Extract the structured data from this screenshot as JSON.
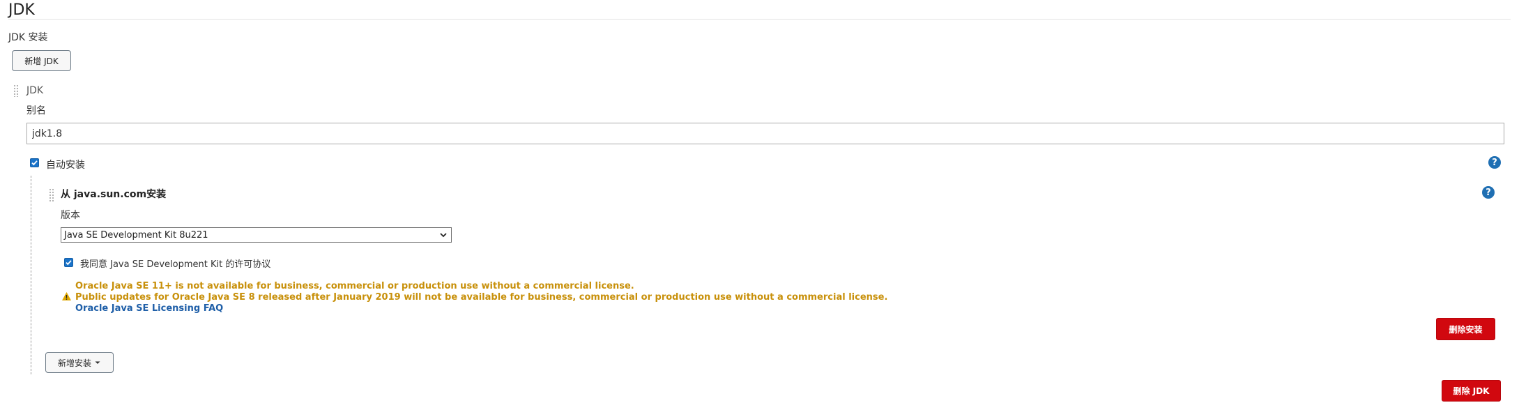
{
  "section": {
    "title": "JDK"
  },
  "jdk_installations": {
    "label": "JDK 安装",
    "add_button": "新增 JDK",
    "delete_button": "删除 JDK"
  },
  "jdk": {
    "header": "JDK",
    "alias_label": "别名",
    "alias_value": "jdk1.8",
    "auto_install_label": "自动安装",
    "auto_install_checked": true
  },
  "installer": {
    "title": "从 java.sun.com安装",
    "version_label": "版本",
    "version_selected": "Java SE Development Kit 8u221",
    "agree_label": "我同意 Java SE Development Kit 的许可协议",
    "agree_checked": true,
    "warning_line1": "Oracle Java SE 11+ is not available for business, commercial or production use without a commercial license.",
    "warning_line2": "Public updates for Oracle Java SE 8 released after January 2019 will not be available for business, commercial or production use without a commercial license.",
    "faq_link": "Oracle Java SE Licensing FAQ",
    "delete_button": "删除安装",
    "add_installer_button": "新增安装"
  },
  "colors": {
    "primary": "#1a73c9",
    "danger": "#d1080f",
    "warning": "#c8900a",
    "link": "#1f5fa8"
  },
  "icons": [
    "help-icon",
    "warning-icon",
    "caret-down-icon",
    "check-icon",
    "drag-handle-icon"
  ]
}
